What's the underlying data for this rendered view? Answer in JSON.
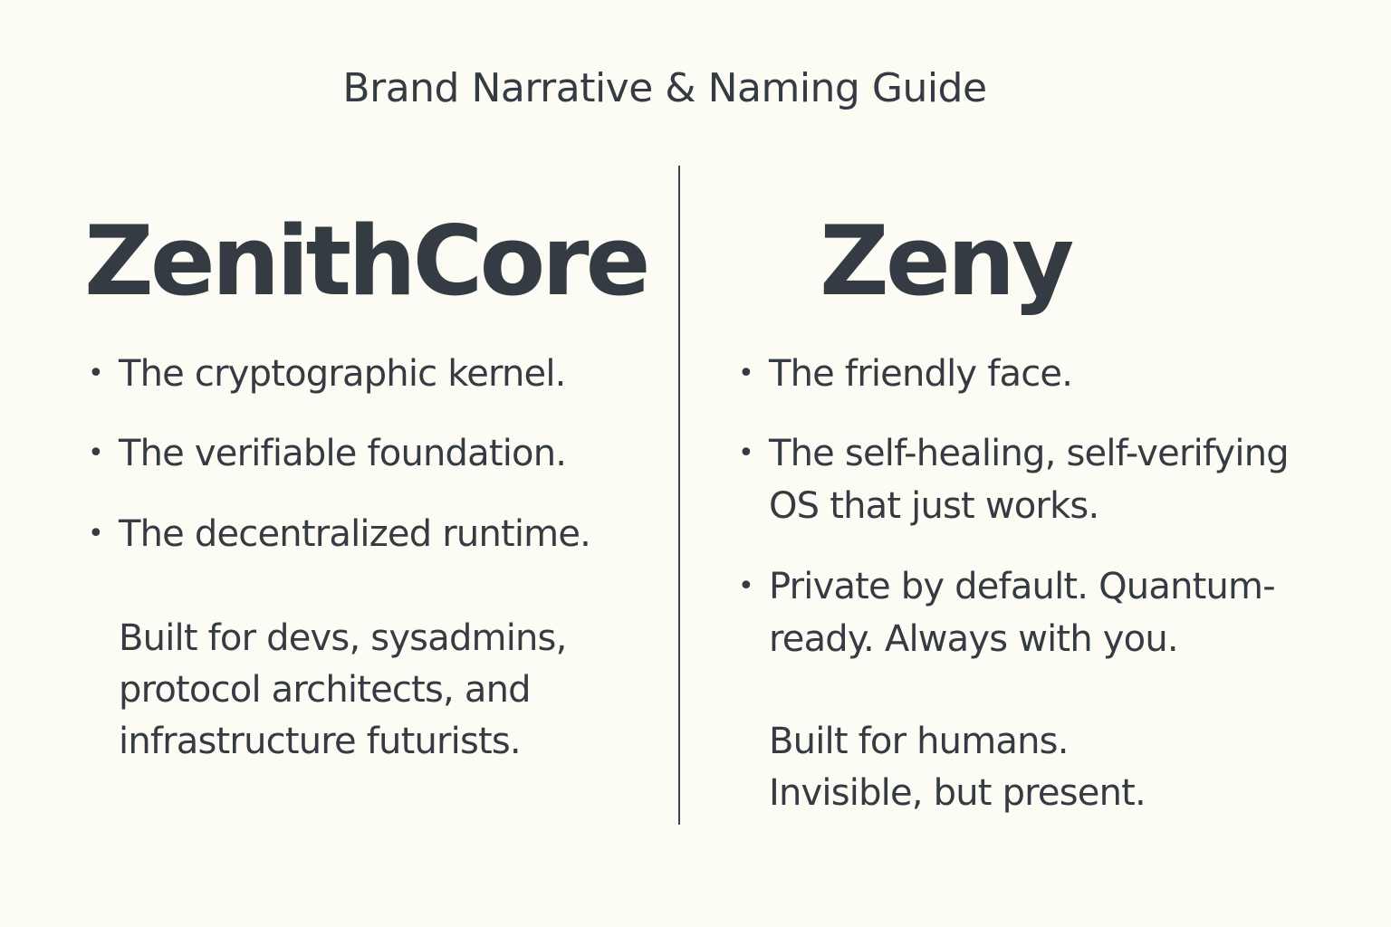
{
  "title": "Brand Narrative & Naming Guide",
  "left": {
    "name": "ZenithCore",
    "bullets": [
      [
        "The cryptographic kernel."
      ],
      [
        "The verifiable foundation."
      ],
      [
        "The decentralized runtime."
      ]
    ],
    "audience": [
      "Built for devs, sysadmins,",
      "protocol architects, and",
      "infrastructure futurists."
    ]
  },
  "right": {
    "name": "Zeny",
    "bullets": [
      [
        "The friendly face."
      ],
      [
        "The self-healing, self-verifying",
        "OS that just works."
      ],
      [
        "Private by default. Quantum-",
        "ready. Always with you."
      ]
    ],
    "audience": [
      "Built for humans.",
      "Invisible, but present."
    ]
  }
}
